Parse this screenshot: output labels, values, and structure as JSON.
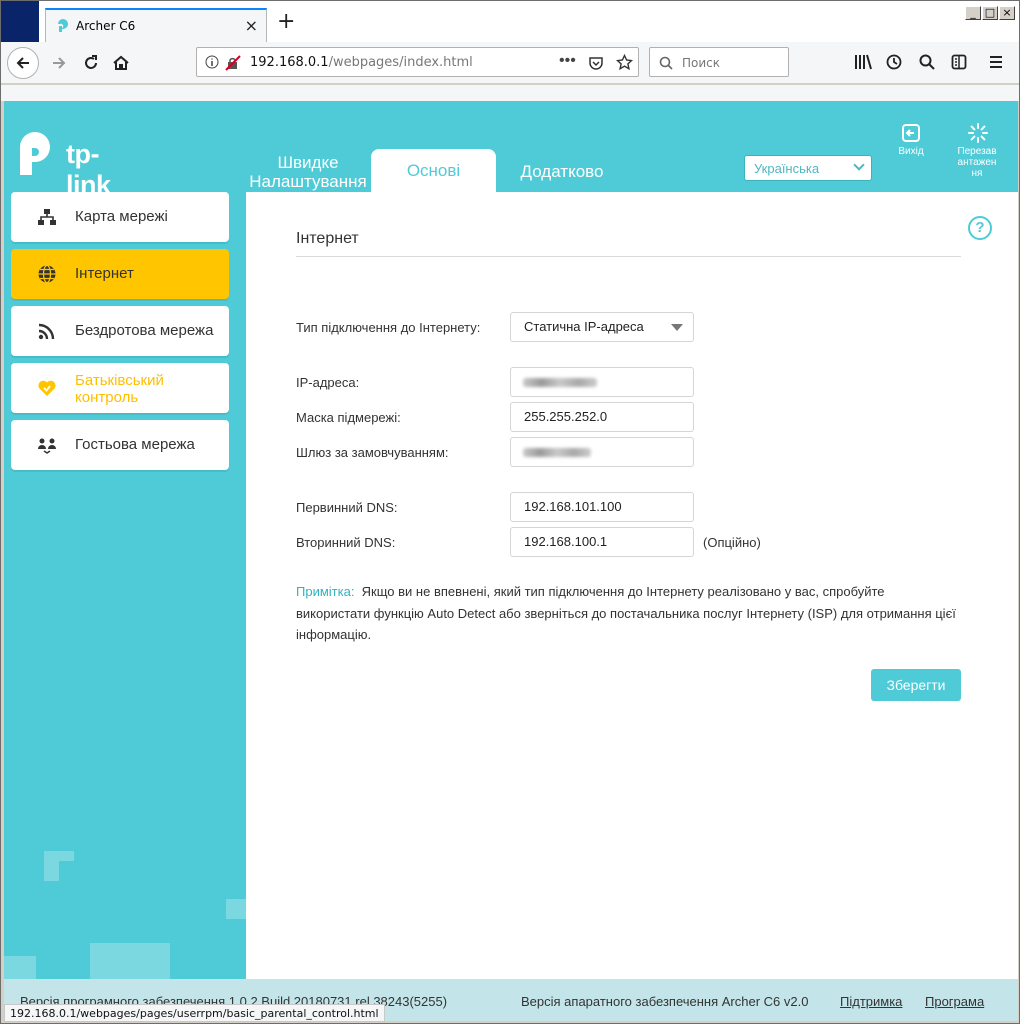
{
  "browser": {
    "tab_title": "Archer C6",
    "url_host": "192.168.0.1",
    "url_path": "/webpages/index.html",
    "search_placeholder": "Поиск",
    "status_url": "192.168.0.1/webpages/pages/userrpm/basic_parental_control.html"
  },
  "header": {
    "brand": "tp-link",
    "tabs": {
      "quick": "Швидке Налаштування",
      "basic": "Основі",
      "advanced": "Додатково"
    },
    "language": "Українська",
    "exit_label": "Вихід",
    "reboot_label": "Перезав антажен ня"
  },
  "sidebar": {
    "items": [
      {
        "label": "Карта мережі",
        "icon": "network-map-icon"
      },
      {
        "label": "Інтернет",
        "icon": "globe-icon"
      },
      {
        "label": "Бездротова мережа",
        "icon": "wireless-icon"
      },
      {
        "label": "Батьківський контроль",
        "icon": "parental-heart-icon"
      },
      {
        "label": "Гостьова мережа",
        "icon": "guest-network-icon"
      }
    ]
  },
  "main": {
    "section_title": "Інтернет",
    "connection_type_label": "Тип підключення до Інтернету:",
    "connection_type_value": "Статична IP-адреса",
    "ip_label": "IP-адреса:",
    "mask_label": "Маска підмережі:",
    "mask_value": "255.255.252.0",
    "gateway_label": "Шлюз за замовчуванням:",
    "dns1_label": "Первинний DNS:",
    "dns1_value": "192.168.101.100",
    "dns2_label": "Вторинний DNS:",
    "dns2_value": "192.168.100.1",
    "optional": "(Опційно)",
    "note_label": "Примітка:",
    "note_text": "Якщо ви не впевнені, який тип підключення до Інтернету реалізовано у вас, спробуйте використати функцію Auto Detect або зверніться до постачальника послуг Інтернету (ISP) для отримання цієї інформацію.",
    "save_button": "Зберегти",
    "help_icon": "?"
  },
  "footer": {
    "firmware": "Версія програмного забезпечення 1.0.2 Build 20180731 rel.38243(5255)",
    "hardware": "Версія апаратного забезпечення Archer C6 v2.0",
    "support": "Підтримка",
    "app": "Програма"
  },
  "colors": {
    "teal": "#4fcbd7",
    "active_yellow": "#ffc600",
    "note_blue": "#31b2c3"
  }
}
